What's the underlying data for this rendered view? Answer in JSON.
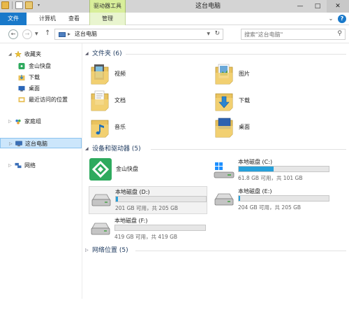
{
  "titlebar": {
    "window_title": "这台电脑",
    "contextual_tab_group": "驱动器工具",
    "min": "—",
    "max": "□",
    "close": "✕"
  },
  "ribbon": {
    "tabs": [
      {
        "label": "文件"
      },
      {
        "label": "计算机"
      },
      {
        "label": "查看"
      },
      {
        "label": "管理"
      }
    ],
    "collapse": "⌄",
    "help": "?"
  },
  "address": {
    "path": "这台电脑",
    "separator": "▸",
    "search_placeholder": "搜索\"这台电脑\""
  },
  "nav": {
    "items": [
      {
        "label": "收藏夹",
        "icon": "star-icon"
      },
      {
        "label": "金山快盘",
        "icon": "kuaipan-icon"
      },
      {
        "label": "下载",
        "icon": "download-folder-icon"
      },
      {
        "label": "桌面",
        "icon": "desktop-icon"
      },
      {
        "label": "最近访问的位置",
        "icon": "recent-places-icon"
      },
      {
        "label": "家庭组",
        "icon": "homegroup-icon"
      },
      {
        "label": "这台电脑",
        "icon": "computer-icon"
      },
      {
        "label": "网络",
        "icon": "network-icon"
      }
    ]
  },
  "groups": {
    "folders": {
      "title": "文件夹 (6)"
    },
    "devices": {
      "title": "设备和驱动器 (5)"
    },
    "network": {
      "title": "网络位置 (5)"
    }
  },
  "folders": [
    {
      "label": "视频",
      "icon": "videos-folder-icon"
    },
    {
      "label": "图片",
      "icon": "pictures-folder-icon"
    },
    {
      "label": "文档",
      "icon": "documents-folder-icon"
    },
    {
      "label": "下载",
      "icon": "downloads-folder-icon"
    },
    {
      "label": "音乐",
      "icon": "music-folder-icon"
    },
    {
      "label": "桌面",
      "icon": "desktop-folder-icon"
    }
  ],
  "devices": {
    "kuaipan": {
      "label": "金山快盘"
    },
    "drives": [
      {
        "name": "本地磁盘 (C:)",
        "free": "61.8 GB 可用，共 101 GB",
        "used_fraction": 0.39,
        "system": true
      },
      {
        "name": "本地磁盘 (D:)",
        "free": "201 GB 可用，共 205 GB",
        "used_fraction": 0.02,
        "system": false
      },
      {
        "name": "本地磁盘 (E:)",
        "free": "204 GB 可用，共 205 GB",
        "used_fraction": 0.005,
        "system": false
      },
      {
        "name": "本地磁盘 (F:)",
        "free": "419 GB 可用，共 419 GB",
        "used_fraction": 0.0,
        "system": false
      }
    ]
  },
  "colors": {
    "accent": "#1979ca",
    "drive_fill": "#26a0da",
    "selection": "#cce6fb",
    "contextual_tab": "#d8ee9a"
  }
}
